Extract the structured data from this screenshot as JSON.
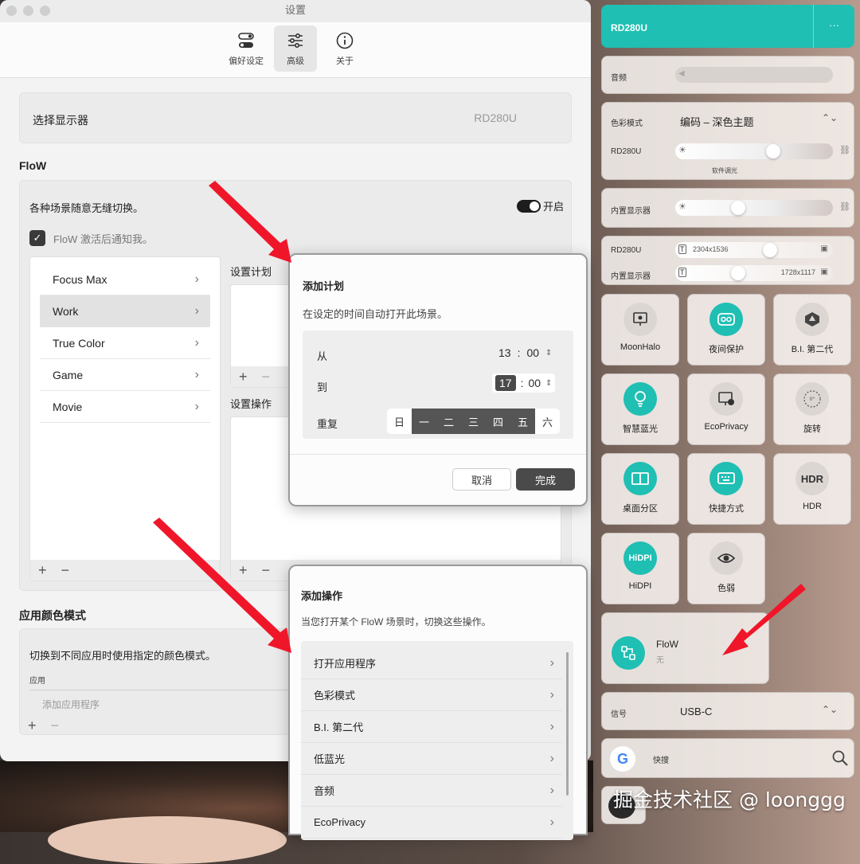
{
  "window": {
    "title": "设置"
  },
  "toolbar": {
    "tabs": [
      {
        "label": "偏好设定"
      },
      {
        "label": "高级"
      },
      {
        "label": "关于"
      }
    ]
  },
  "display_select": {
    "label": "选择显示器",
    "value": "RD280U"
  },
  "flow": {
    "section_title": "FloW",
    "description": "各种场景随意无缝切换。",
    "toggle_label": "开启",
    "notify_label": "FloW 激活后通知我。",
    "scenes": [
      "Focus Max",
      "Work",
      "True Color",
      "Game",
      "Movie"
    ],
    "schedule_title": "设置计划",
    "actions_title": "设置操作"
  },
  "app_color": {
    "section_title": "应用颜色模式",
    "description": "切换到不同应用时使用指定的颜色模式。",
    "column": "应用",
    "placeholder": "添加应用程序"
  },
  "add_plan": {
    "title": "添加计划",
    "subtitle": "在设定的时间自动打开此场景。",
    "from_label": "从",
    "from_hour": "13",
    "from_min": "00",
    "to_label": "到",
    "to_hour": "17",
    "to_min": "00",
    "repeat_label": "重复",
    "days": [
      "日",
      "一",
      "二",
      "三",
      "四",
      "五",
      "六"
    ],
    "cancel": "取消",
    "done": "完成"
  },
  "add_action": {
    "title": "添加操作",
    "subtitle": "当您打开某个 FloW 场景时，切换这些操作。",
    "items": [
      "打开应用程序",
      "色彩模式",
      "B.I. 第二代",
      "低蓝光",
      "音频",
      "EcoPrivacy"
    ]
  },
  "panel": {
    "device": "RD280U",
    "more": "···",
    "audio_label": "音频",
    "color_mode_label": "色彩模式",
    "color_mode_value": "编码 – 深色主题",
    "brightness_label": "RD280U",
    "software_dim": "软件调光",
    "builtin_label": "内置显示器",
    "res_rows": [
      {
        "label": "RD280U",
        "value": "2304x1536"
      },
      {
        "label": "内置显示器",
        "value": "1728x1117"
      }
    ],
    "tiles": [
      "MoonHalo",
      "夜间保护",
      "B.I. 第二代",
      "智慧蓝光",
      "EcoPrivacy",
      "旋转",
      "桌面分区",
      "快捷方式",
      "HDR",
      "HiDPI",
      "色弱"
    ],
    "hdr_glyph": "HDR",
    "hidpi_glyph": "HiDPI",
    "flow_title": "FloW",
    "flow_sub": "无",
    "signal_label": "信号",
    "signal_value": "USB-C",
    "search_label": "快搜",
    "google_glyph": "G"
  },
  "watermark": "掘金技术社区 @ loonggg",
  "colors": {
    "teal": "#1fbfb3",
    "dark_button": "#4a4a4a",
    "arrow_red": "#f0162a"
  }
}
